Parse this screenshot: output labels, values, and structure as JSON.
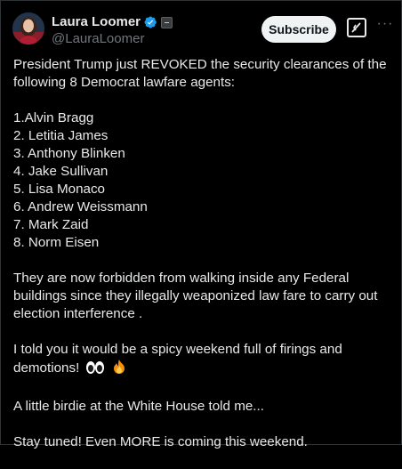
{
  "author": {
    "display_name": "Laura Loomer",
    "handle": "@LauraLoomer",
    "verified_color": "#1d9bf0"
  },
  "actions": {
    "subscribe_label": "Subscribe",
    "grok_icon": "grok-icon",
    "more_icon": "more-options-icon",
    "more_glyph": "···"
  },
  "post": {
    "intro": "President Trump just REVOKED the security clearances of the following 8 Democrat lawfare agents:",
    "list": [
      "1.Alvin Bragg",
      "2. Letitia James",
      "3. Anthony Blinken",
      "4. Jake Sullivan",
      "5. Lisa Monaco",
      "6. Andrew Weissmann",
      "7. Mark Zaid",
      "8. Norm Eisen"
    ],
    "para2": "They are now forbidden from walking inside any Federal buildings since they illegally weaponized law fare to carry out election interference .",
    "para3": "I told you it would be a spicy weekend full of firings and demotions!",
    "para4": "A little birdie at the White House told me...",
    "para5": "Stay tuned! Even MORE is coming this weekend."
  },
  "colors": {
    "background": "#000000",
    "text": "#e7e9ea",
    "secondary": "#71767b",
    "accent": "#1d9bf0"
  }
}
